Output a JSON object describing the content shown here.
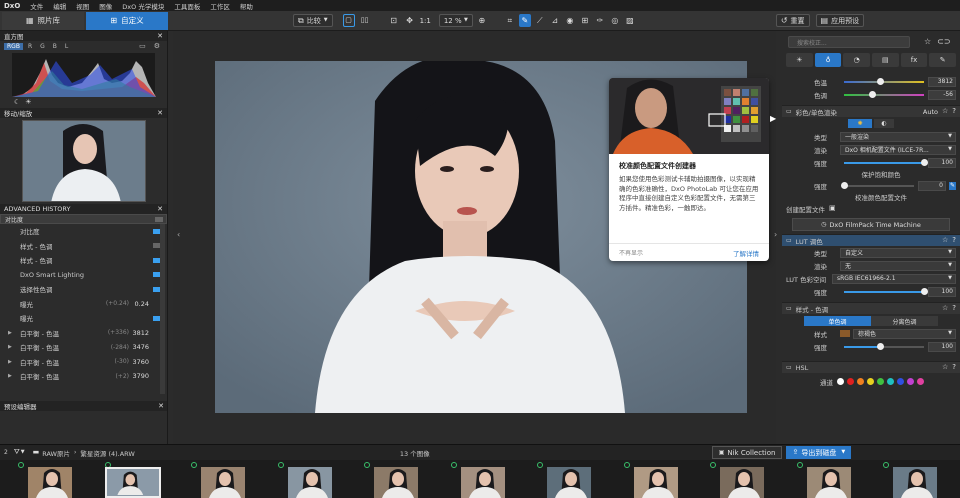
{
  "menubar": {
    "logo": "DxO",
    "items": [
      "文件",
      "编辑",
      "视图",
      "图像",
      "DxO 光学模块",
      "工具面板",
      "工作区",
      "帮助"
    ]
  },
  "toolbar": {
    "tab_library": "照片库",
    "tab_customize": "自定义",
    "compare_label": "比较",
    "zoom_ratio": "1:1",
    "zoom_value": "12 %",
    "reset_label": "重置",
    "apply_preset_label": "应用预设"
  },
  "left_panel": {
    "histogram": {
      "title": "直方图",
      "channels": [
        "RGB",
        "R",
        "G",
        "B",
        "L"
      ],
      "active_channel": "RGB"
    },
    "navigator_title": "移动/缩放",
    "history": {
      "title": "ADVANCED HISTORY",
      "items": [
        {
          "label": "对比度",
          "delta": "",
          "value": "",
          "expand": false,
          "indicator": "gray"
        },
        {
          "label": "对比度",
          "delta": "",
          "value": "",
          "expand": false,
          "indicator": "blue"
        },
        {
          "label": "样式 - 色调",
          "delta": "",
          "value": "",
          "expand": false,
          "indicator": "gray"
        },
        {
          "label": "样式 - 色调",
          "delta": "",
          "value": "",
          "expand": false,
          "indicator": "blue"
        },
        {
          "label": "DxO Smart Lighting",
          "delta": "",
          "value": "",
          "expand": false,
          "indicator": "blue"
        },
        {
          "label": "选择性色调",
          "delta": "",
          "value": "",
          "expand": false,
          "indicator": "blue"
        },
        {
          "label": "曝光",
          "delta": "(+0.24)",
          "value": "0.24",
          "expand": false,
          "indicator": ""
        },
        {
          "label": "曝光",
          "delta": "",
          "value": "",
          "expand": false,
          "indicator": "blue"
        },
        {
          "label": "白平衡 - 色温",
          "delta": "(+336)",
          "value": "3812",
          "expand": true,
          "indicator": ""
        },
        {
          "label": "白平衡 - 色温",
          "delta": "(-284)",
          "value": "3476",
          "expand": true,
          "indicator": ""
        },
        {
          "label": "白平衡 - 色温",
          "delta": "(-30)",
          "value": "3760",
          "expand": true,
          "indicator": ""
        },
        {
          "label": "白平衡 - 色温",
          "delta": "(+2)",
          "value": "3790",
          "expand": true,
          "indicator": ""
        }
      ]
    },
    "preset_editor_title": "预设编辑器"
  },
  "tooltip": {
    "title": "校准颜色配置文件创建器",
    "body": "如果您使用色彩测试卡辅助拍摄图像，以实现精确的色彩准确性，DxO PhotoLab 可让您在应用程序中直接创建自定义色彩配置文件，无需第三方插件。精准色彩，一触即达。",
    "dismiss": "不再显示",
    "learn_more": "了解详情"
  },
  "right_panel": {
    "search_placeholder": "搜索校正...",
    "tabs": [
      "☀",
      "♁",
      "◔",
      "▤",
      "fx",
      "✎"
    ],
    "active_tab": 1,
    "wb": {
      "temp_label": "色温",
      "temp_value": "3812",
      "temp_pos": 0.45,
      "tint_label": "色调",
      "tint_value": "-56",
      "tint_pos": 0.35
    },
    "color_render": {
      "title": "彩色/单色渲染",
      "mode": "Auto",
      "type_label": "类型",
      "type_value": "一般渲染",
      "render_label": "渲染",
      "render_value": "DxO 相机配置文件 (ILCE-7R...",
      "strength_label": "强度",
      "strength_value": "100",
      "strength_pos": 1.0,
      "protect_label": "保护饱和颜色",
      "protect_strength_label": "强度",
      "protect_strength_value": "0",
      "protect_pos": 0.0,
      "calibration_label": "校准颜色配置文件",
      "create_profile_label": "创建配置文件",
      "filmpack_label": "DxO FilmPack Time Machine"
    },
    "lut": {
      "title": "LUT 调色",
      "type_label": "类型",
      "type_value": "自定义",
      "render_label": "渲染",
      "render_value": "无",
      "space_label": "LUT 色彩空间",
      "space_value": "sRGB IEC61966-2.1",
      "strength_label": "强度",
      "strength_value": "100",
      "strength_pos": 1.0
    },
    "style_tone": {
      "title": "样式 - 色调",
      "subtab_a": "单色调",
      "subtab_b": "分离色调",
      "style_label": "样式",
      "style_value": "棕褐色",
      "strength_label": "强度",
      "strength_value": "100",
      "strength_pos": 0.45
    },
    "hsl": {
      "title": "HSL",
      "channel_label": "通道",
      "swatches": [
        "#ffffff",
        "#e02020",
        "#f08020",
        "#e8d020",
        "#40c040",
        "#20c0c0",
        "#3050e0",
        "#c040d0",
        "#e040a0"
      ]
    }
  },
  "bottombar": {
    "count_label": "2",
    "path": "RAW原片",
    "filename": "繁星资源 (4).ARW",
    "image_count": "13 个图像",
    "nik_label": "Nik Collection",
    "export_label": "导出到磁盘"
  },
  "filmstrip": {
    "count": 12,
    "selected_index": 1
  }
}
